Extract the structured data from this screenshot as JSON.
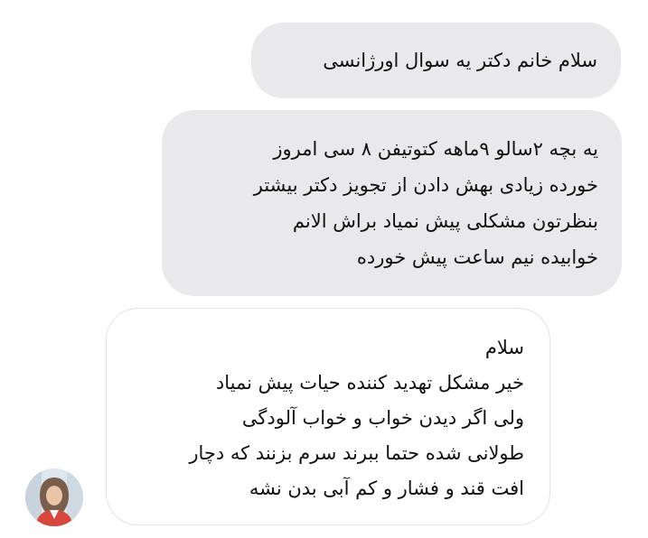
{
  "conversation": {
    "messages": [
      {
        "sender": "patient",
        "lines": [
          "سلام خانم دکتر یه سوال اورژانسی"
        ]
      },
      {
        "sender": "patient",
        "lines": [
          "یه بچه ۲سالو ۹ماهه کتوتیفن ۸ سی امروز",
          "خورده زیادی بهش دادن از تجویز دکتر بیشتر",
          "بنظرتون مشکلی پیش نمیاد براش الانم",
          "خوابیده نیم ساعت پیش خورده"
        ]
      },
      {
        "sender": "doctor",
        "lines": [
          "سلام",
          "خیر مشکل تهدید کننده حیات پیش نمیاد",
          "ولی  اگر دیدن خواب و خواب آلودگی",
          "طولانی شده حتما ببرند سرم بزنند که دچار",
          "افت قند و فشار و کم آبی  بدن نشه"
        ]
      }
    ]
  },
  "avatar": {
    "icon": "doctor-avatar",
    "colors": {
      "coat": "#d9463c",
      "hijab": "#7a5e4c",
      "skin": "#e9c4a6",
      "background": "#dfe7ee"
    }
  },
  "colors": {
    "incoming_bubble": "#e9e9eb",
    "reply_border": "#e2e2e2",
    "text": "#111111"
  }
}
